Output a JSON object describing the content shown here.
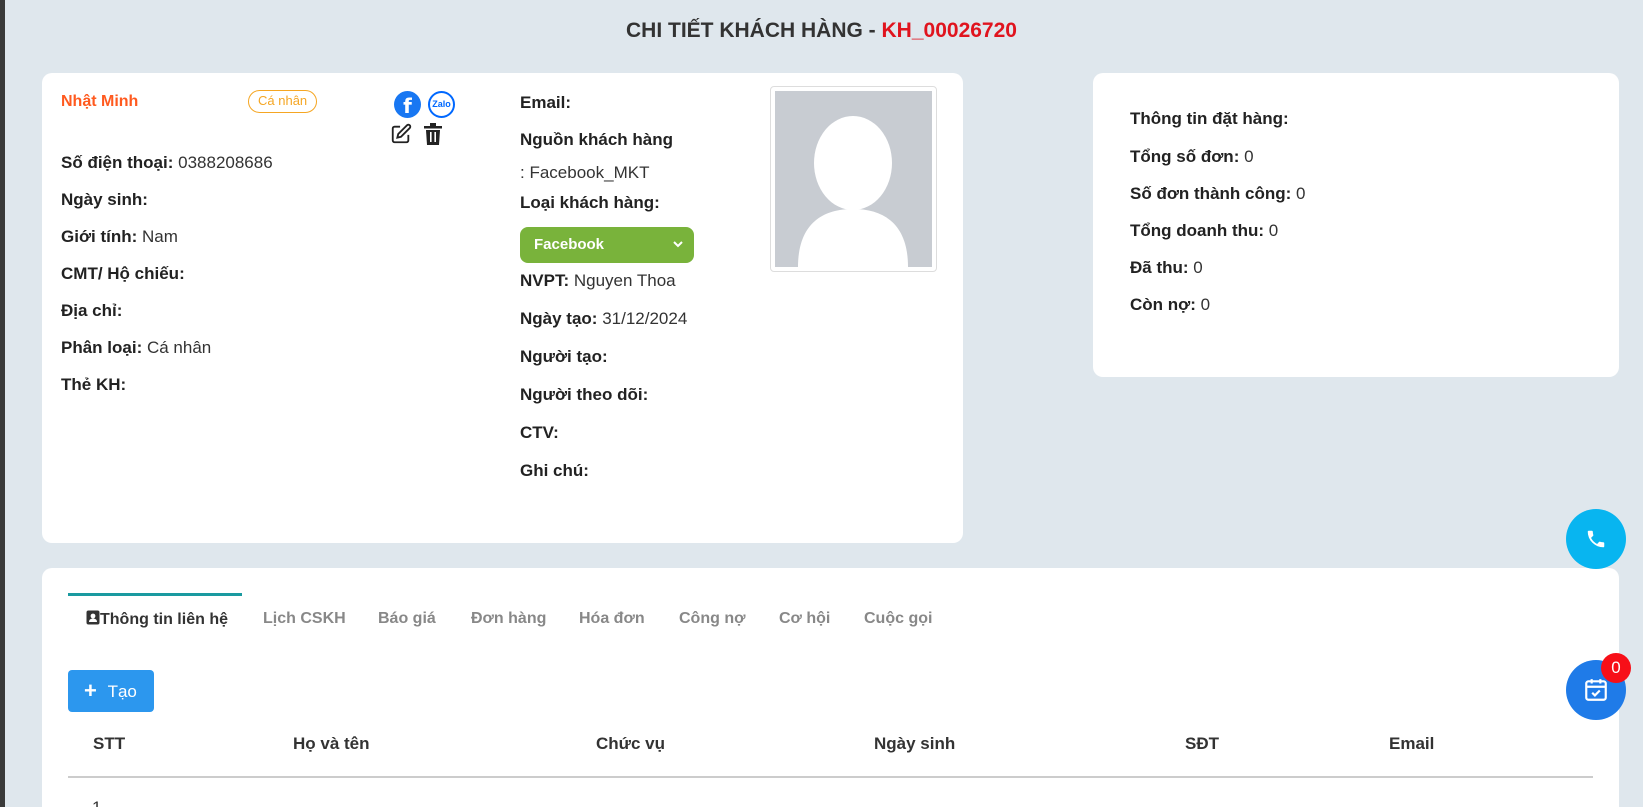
{
  "page": {
    "title_prefix": "CHI TIẾT KHÁCH HÀNG - ",
    "customer_code": "KH_00026720"
  },
  "customer": {
    "name": "Nhật Minh",
    "badge": "Cá nhân",
    "social": {
      "facebook_icon_letter": "f",
      "zalo_icon_text": "Zalo"
    },
    "left_fields": [
      {
        "label": "Số điện thoại",
        "value": "0388208686"
      },
      {
        "label": "Ngày sinh",
        "value": ""
      },
      {
        "label": "Giới tính",
        "value": "Nam"
      },
      {
        "label": "CMT/ Hộ chiếu",
        "value": ""
      },
      {
        "label": "Địa chỉ",
        "value": ""
      },
      {
        "label": "Phân loại",
        "value": "Cá nhân"
      },
      {
        "label": "Thẻ KH",
        "value": ""
      }
    ],
    "email_label": "Email",
    "source_label": "Nguồn khách hàng",
    "source_value": "Facebook_MKT",
    "type_label": "Loại khách hàng",
    "type_selected": "Facebook",
    "right_fields": [
      {
        "label": "NVPT",
        "value": "Nguyen Thoa"
      },
      {
        "label": "Ngày tạo",
        "value": "31/12/2024"
      },
      {
        "label": "Người tạo",
        "value": ""
      },
      {
        "label": "Người theo dõi",
        "value": ""
      },
      {
        "label": "CTV",
        "value": ""
      },
      {
        "label": "Ghi chú",
        "value": ""
      }
    ]
  },
  "orders": {
    "heading": "Thông tin đặt hàng",
    "fields": [
      {
        "label": "Tổng số đơn",
        "value": "0"
      },
      {
        "label": "Số đơn thành công",
        "value": "0"
      },
      {
        "label": "Tổng doanh thu",
        "value": "0"
      },
      {
        "label": "Đã thu",
        "value": "0"
      },
      {
        "label": "Còn nợ",
        "value": "0"
      }
    ]
  },
  "tabs": [
    {
      "label": "Thông tin liên hệ",
      "active": true
    },
    {
      "label": "Lịch CSKH"
    },
    {
      "label": "Báo giá"
    },
    {
      "label": "Đơn hàng"
    },
    {
      "label": "Hóa đơn"
    },
    {
      "label": "Công nợ"
    },
    {
      "label": "Cơ hội"
    },
    {
      "label": "Cuộc gọi"
    }
  ],
  "table": {
    "create_label": "Tạo",
    "headers": [
      "STT",
      "Họ và tên",
      "Chức vụ",
      "Ngày sinh",
      "SĐT",
      "Email"
    ],
    "first_row_number": "1"
  },
  "floating": {
    "calendar_count": "0"
  },
  "colors": {
    "background": "#dfe7ed",
    "code_red": "#e0141e",
    "name_orange": "#ff5a1f",
    "badge_orange": "#f5a623",
    "type_green": "#79b33b",
    "primary_blue": "#2c97ee",
    "tab_accent": "#1a9aa0"
  }
}
